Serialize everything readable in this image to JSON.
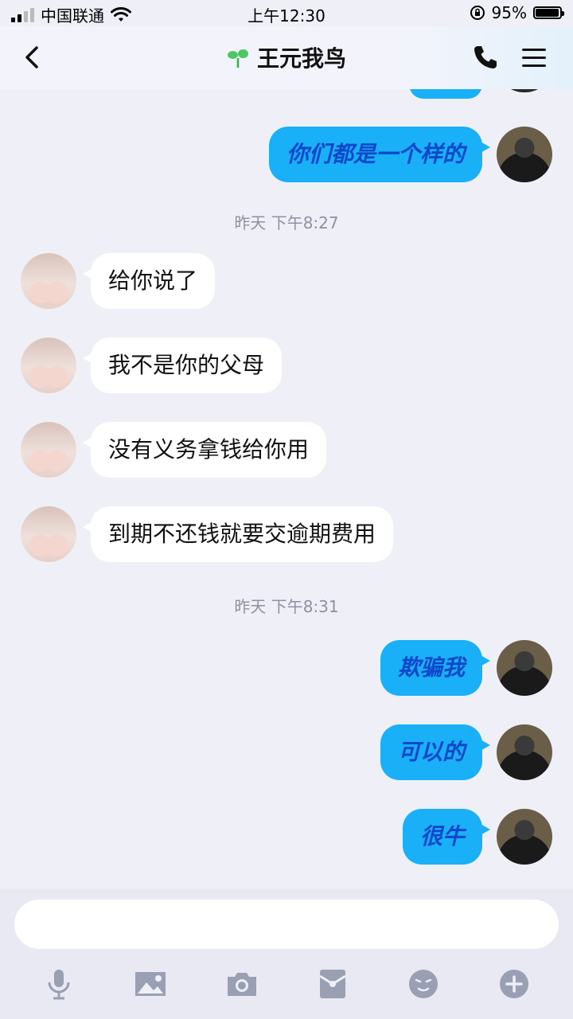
{
  "status_bar": {
    "carrier": "中国联通",
    "time": "上午12:30",
    "battery": "95%",
    "battery_level": 0.95
  },
  "header": {
    "title": "王元我鸟"
  },
  "messages": [
    {
      "side": "out",
      "text": "你们都是一个样的"
    },
    {
      "type": "time",
      "text": "昨天 下午8:27"
    },
    {
      "side": "in",
      "text": "给你说了"
    },
    {
      "side": "in",
      "text": "我不是你的父母"
    },
    {
      "side": "in",
      "text": "没有义务拿钱给你用"
    },
    {
      "side": "in",
      "text": "到期不还钱就要交逾期费用"
    },
    {
      "type": "time",
      "text": "昨天 下午8:31"
    },
    {
      "side": "out",
      "text": "欺骗我"
    },
    {
      "side": "out",
      "text": "可以的"
    },
    {
      "side": "out",
      "text": "很牛"
    }
  ],
  "input": {
    "placeholder": ""
  },
  "toolbar": {
    "icons": [
      "microphone-icon",
      "image-icon",
      "camera-icon",
      "red-packet-icon",
      "emoji-icon",
      "plus-icon"
    ]
  },
  "colors": {
    "outgoing_bubble": "#1ab0f8",
    "outgoing_text": "#0c48c9",
    "incoming_bubble": "#ffffff",
    "background": "#eeeff7"
  }
}
